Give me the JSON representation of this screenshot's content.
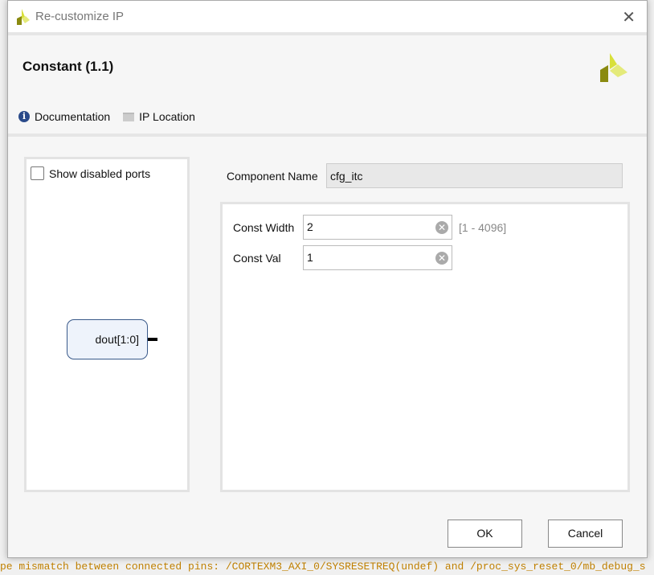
{
  "dialog": {
    "title": "Re-customize IP",
    "close_icon": "close-icon"
  },
  "header": {
    "ip_title": "Constant (1.1)",
    "documentation": "Documentation",
    "ip_location": "IP Location"
  },
  "left": {
    "show_disabled_ports": "Show disabled ports",
    "checked": false,
    "port_label": "dout[1:0]"
  },
  "component": {
    "label": "Component Name",
    "value": "cfg_itc"
  },
  "params": [
    {
      "label": "Const Width",
      "value": "2",
      "range": "[1 - 4096]"
    },
    {
      "label": "Const Val",
      "value": "1"
    }
  ],
  "buttons": {
    "ok": "OK",
    "cancel": "Cancel"
  },
  "background": {
    "log_line": "pe mismatch between connected pins: /CORTEXM3_AXI_0/SYSRESETREQ(undef) and /proc_sys_reset_0/mb_debug_s"
  },
  "colors": {
    "logo_light": "#d8e03a",
    "logo_dark": "#8a8a10",
    "info_icon": "#2a4a8a"
  }
}
